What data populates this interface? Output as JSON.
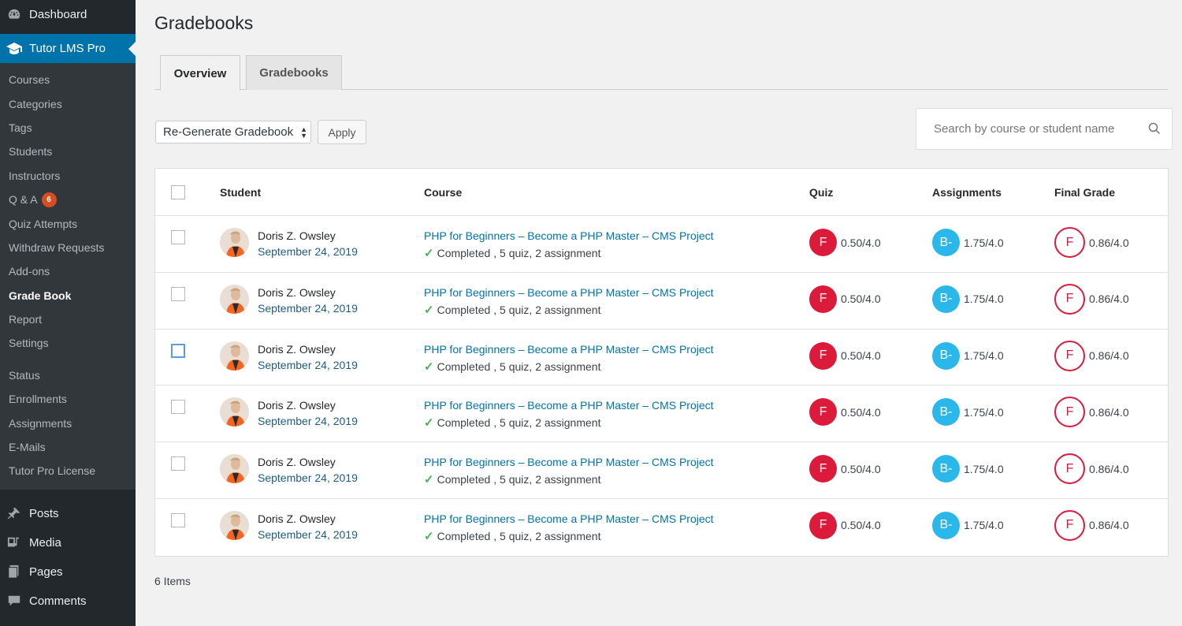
{
  "sidebar": {
    "dashboard": "Dashboard",
    "tutor": "Tutor LMS Pro",
    "sub": [
      {
        "label": "Courses"
      },
      {
        "label": "Categories"
      },
      {
        "label": "Tags"
      },
      {
        "label": "Students"
      },
      {
        "label": "Instructors"
      },
      {
        "label": "Q & A",
        "badge": "6"
      },
      {
        "label": "Quiz Attempts"
      },
      {
        "label": "Withdraw Requests"
      },
      {
        "label": "Add-ons"
      },
      {
        "label": "Grade Book"
      },
      {
        "label": "Report"
      },
      {
        "label": "Settings"
      },
      {
        "label": "Status"
      },
      {
        "label": "Enrollments"
      },
      {
        "label": "Assignments"
      },
      {
        "label": "E-Mails"
      },
      {
        "label": "Tutor Pro License"
      }
    ],
    "lower": [
      "Posts",
      "Media",
      "Pages",
      "Comments"
    ]
  },
  "page": {
    "title": "Gradebooks",
    "tabs": [
      "Overview",
      "Gradebooks"
    ],
    "bulk_action": "Re-Generate Gradebook",
    "apply": "Apply",
    "search_placeholder": "Search by course or student name",
    "footer_count": "6 Items"
  },
  "table": {
    "headers": {
      "student": "Student",
      "course": "Course",
      "quiz": "Quiz",
      "assignments": "Assignments",
      "final": "Final Grade"
    },
    "rows": [
      {
        "name": "Doris Z. Owsley",
        "date": "September 24, 2019",
        "course": "PHP for Beginners – Become a PHP Master – CMS Project",
        "status": "Completed",
        "details": ", 5 quiz, 2 assignment",
        "quiz_grade": "F",
        "quiz_score": "0.50/4.0",
        "assign_grade": "B-",
        "assign_score": "1.75/4.0",
        "final_grade": "F",
        "final_score": "0.86/4.0"
      },
      {
        "name": "Doris Z. Owsley",
        "date": "September 24, 2019",
        "course": "PHP for Beginners – Become a PHP Master – CMS Project",
        "status": "Completed",
        "details": ", 5 quiz, 2 assignment",
        "quiz_grade": "F",
        "quiz_score": "0.50/4.0",
        "assign_grade": "B-",
        "assign_score": "1.75/4.0",
        "final_grade": "F",
        "final_score": "0.86/4.0"
      },
      {
        "name": "Doris Z. Owsley",
        "date": "September 24, 2019",
        "course": "PHP for Beginners – Become a PHP Master – CMS Project",
        "status": "Completed",
        "details": ", 5 quiz, 2 assignment",
        "quiz_grade": "F",
        "quiz_score": "0.50/4.0",
        "assign_grade": "B-",
        "assign_score": "1.75/4.0",
        "final_grade": "F",
        "final_score": "0.86/4.0"
      },
      {
        "name": "Doris Z. Owsley",
        "date": "September 24, 2019",
        "course": "PHP for Beginners – Become a PHP Master – CMS Project",
        "status": "Completed",
        "details": ", 5 quiz, 2 assignment",
        "quiz_grade": "F",
        "quiz_score": "0.50/4.0",
        "assign_grade": "B-",
        "assign_score": "1.75/4.0",
        "final_grade": "F",
        "final_score": "0.86/4.0"
      },
      {
        "name": "Doris Z. Owsley",
        "date": "September 24, 2019",
        "course": "PHP for Beginners – Become a PHP Master – CMS Project",
        "status": "Completed",
        "details": ", 5 quiz, 2 assignment",
        "quiz_grade": "F",
        "quiz_score": "0.50/4.0",
        "assign_grade": "B-",
        "assign_score": "1.75/4.0",
        "final_grade": "F",
        "final_score": "0.86/4.0"
      },
      {
        "name": "Doris Z. Owsley",
        "date": "September 24, 2019",
        "course": "PHP for Beginners – Become a PHP Master – CMS Project",
        "status": "Completed",
        "details": ", 5 quiz, 2 assignment",
        "quiz_grade": "F",
        "quiz_score": "0.50/4.0",
        "assign_grade": "B-",
        "assign_score": "1.75/4.0",
        "final_grade": "F",
        "final_score": "0.86/4.0"
      }
    ]
  },
  "colors": {
    "admin_bar": "#23282d",
    "active_menu": "#0073aa",
    "link": "#0073aa",
    "grade_red": "#dc1a3c",
    "grade_blue": "#2ab7ea",
    "badge": "#d54e21"
  }
}
